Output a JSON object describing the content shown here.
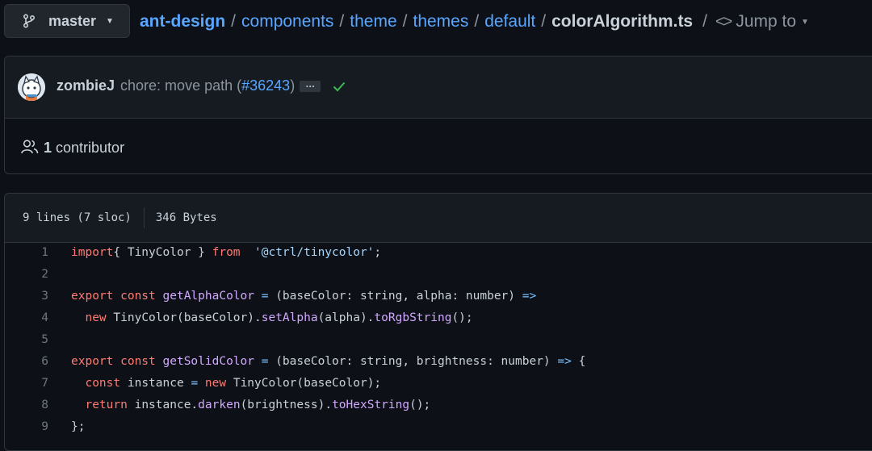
{
  "header": {
    "branch": "master",
    "breadcrumbs": [
      "ant-design",
      "components",
      "theme",
      "themes",
      "default"
    ],
    "separator": "/",
    "file_name": "colorAlgorithm.ts",
    "jump_to": "Jump to"
  },
  "commit": {
    "author": "zombieJ",
    "message": "chore: move path (",
    "pr_link": "#36243",
    "message_end": ")",
    "ellipsis": "…",
    "status": "success"
  },
  "contributors": {
    "count": "1",
    "label": "contributor"
  },
  "file_info": {
    "lines": "9 lines (7 sloc)",
    "size": "346 Bytes"
  },
  "code": {
    "line_numbers": [
      "1",
      "2",
      "3",
      "4",
      "5",
      "6",
      "7",
      "8",
      "9"
    ],
    "lines": [
      [
        [
          "kw",
          "import"
        ],
        [
          "",
          "{ TinyColor } "
        ],
        [
          "kw",
          "from"
        ],
        [
          "",
          "  "
        ],
        [
          "str",
          "'@ctrl/tinycolor'"
        ],
        [
          "",
          ";"
        ]
      ],
      [],
      [
        [
          "kw",
          "export const"
        ],
        [
          "",
          " "
        ],
        [
          "fn",
          "getAlphaColor"
        ],
        [
          "",
          " "
        ],
        [
          "op",
          "="
        ],
        [
          "",
          " (baseColor: string, alpha: number) "
        ],
        [
          "op",
          "=>"
        ]
      ],
      [
        [
          "",
          "  "
        ],
        [
          "kw",
          "new"
        ],
        [
          "",
          " TinyColor(baseColor)."
        ],
        [
          "fn",
          "setAlpha"
        ],
        [
          "",
          "(alpha)."
        ],
        [
          "fn",
          "toRgbString"
        ],
        [
          "",
          "();"
        ]
      ],
      [],
      [
        [
          "kw",
          "export const"
        ],
        [
          "",
          " "
        ],
        [
          "fn",
          "getSolidColor"
        ],
        [
          "",
          " "
        ],
        [
          "op",
          "="
        ],
        [
          "",
          " (baseColor: string, brightness: number) "
        ],
        [
          "op",
          "=>"
        ],
        [
          "",
          " {"
        ]
      ],
      [
        [
          "",
          "  "
        ],
        [
          "kw",
          "const"
        ],
        [
          "",
          " instance "
        ],
        [
          "op",
          "="
        ],
        [
          "",
          " "
        ],
        [
          "kw",
          "new"
        ],
        [
          "",
          " TinyColor(baseColor);"
        ]
      ],
      [
        [
          "",
          "  "
        ],
        [
          "kw",
          "return"
        ],
        [
          "",
          " instance."
        ],
        [
          "fn",
          "darken"
        ],
        [
          "",
          "(brightness)."
        ],
        [
          "fn",
          "toHexString"
        ],
        [
          "",
          "();"
        ]
      ],
      [
        [
          "",
          "};"
        ]
      ]
    ]
  }
}
